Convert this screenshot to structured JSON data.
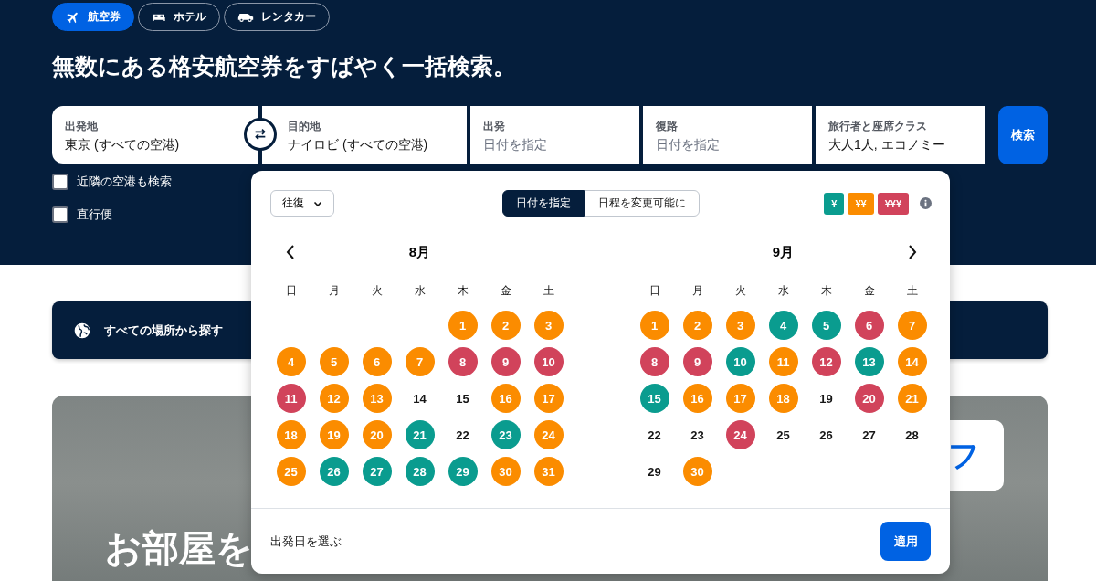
{
  "tabs": [
    {
      "label": "航空券",
      "selected": true
    },
    {
      "label": "ホテル",
      "selected": false
    },
    {
      "label": "レンタカー",
      "selected": false
    }
  ],
  "headline": "無数にある格安航空券をすばやく一括検索。",
  "fields": [
    {
      "label": "出発地",
      "value": "東京 (すべての空港)"
    },
    {
      "label": "目的地",
      "value": "ナイロビ (すべての空港)"
    },
    {
      "label": "出発",
      "placeholder": "日付を指定"
    },
    {
      "label": "復路",
      "placeholder": "日付を指定"
    },
    {
      "label": "旅行者と座席クラス",
      "value": "大人1人, エコノミー"
    }
  ],
  "search_button": "検索",
  "options": [
    {
      "label": "近隣の空港も検索",
      "checked": false
    },
    {
      "label": "直行便",
      "checked": false
    }
  ],
  "explore": "すべての場所から探す",
  "hero": {
    "headline": "お部屋を",
    "card_text": "フ"
  },
  "date_picker": {
    "trip_type": "往復",
    "modes": [
      {
        "label": "日付を指定",
        "selected": true
      },
      {
        "label": "日程を変更可能に",
        "selected": false
      }
    ],
    "legend": [
      {
        "label": "¥",
        "color": "#0a9c8f"
      },
      {
        "label": "¥¥",
        "color": "#fb8c00"
      },
      {
        "label": "¥¥¥",
        "color": "#d1435b"
      }
    ],
    "months": [
      {
        "title": "8月",
        "weekdays": [
          "日",
          "月",
          "火",
          "水",
          "木",
          "金",
          "土"
        ],
        "weeks": [
          [
            {
              "day": "1",
              "color": "#fb8c00"
            },
            {
              "day": "2",
              "color": "#fb8c00"
            },
            {
              "day": "3",
              "color": "#fb8c00"
            }
          ],
          [
            {
              "day": "4",
              "color": "#fb8c00"
            },
            {
              "day": "5",
              "color": "#fb8c00"
            },
            {
              "day": "6",
              "color": "#fb8c00"
            },
            {
              "day": "7",
              "color": "#fb8c00"
            },
            {
              "day": "8",
              "color": "#d1435b"
            },
            {
              "day": "9",
              "color": "#d1435b"
            },
            {
              "day": "10",
              "color": "#d1435b"
            }
          ],
          [
            {
              "day": "11",
              "color": "#d1435b"
            },
            {
              "day": "12",
              "color": "#fb8c00"
            },
            {
              "day": "13",
              "color": "#fb8c00"
            },
            {
              "day": "14"
            },
            {
              "day": "15"
            },
            {
              "day": "16",
              "color": "#fb8c00"
            },
            {
              "day": "17",
              "color": "#fb8c00"
            }
          ],
          [
            {
              "day": "18",
              "color": "#fb8c00"
            },
            {
              "day": "19",
              "color": "#fb8c00"
            },
            {
              "day": "20",
              "color": "#fb8c00"
            },
            {
              "day": "21",
              "color": "#0a9c8f"
            },
            {
              "day": "22"
            },
            {
              "day": "23",
              "color": "#0a9c8f"
            },
            {
              "day": "24",
              "color": "#fb8c00"
            }
          ],
          [
            {
              "day": "25",
              "color": "#fb8c00"
            },
            {
              "day": "26",
              "color": "#0a9c8f"
            },
            {
              "day": "27",
              "color": "#0a9c8f"
            },
            {
              "day": "28",
              "color": "#0a9c8f"
            },
            {
              "day": "29",
              "color": "#0a9c8f"
            },
            {
              "day": "30",
              "color": "#fb8c00"
            },
            {
              "day": "31",
              "color": "#fb8c00"
            }
          ]
        ]
      },
      {
        "title": "9月",
        "weekdays": [
          "日",
          "月",
          "火",
          "水",
          "木",
          "金",
          "土"
        ],
        "weeks": [
          [
            {
              "day": "1",
              "color": "#fb8c00"
            },
            {
              "day": "2",
              "color": "#fb8c00"
            },
            {
              "day": "3",
              "color": "#fb8c00"
            },
            {
              "day": "4",
              "color": "#0a9c8f"
            },
            {
              "day": "5",
              "color": "#0a9c8f"
            },
            {
              "day": "6",
              "color": "#d1435b"
            },
            {
              "day": "7",
              "color": "#fb8c00"
            }
          ],
          [
            {
              "day": "8",
              "color": "#d1435b"
            },
            {
              "day": "9",
              "color": "#d1435b"
            },
            {
              "day": "10",
              "color": "#0a9c8f"
            },
            {
              "day": "11",
              "color": "#fb8c00"
            },
            {
              "day": "12",
              "color": "#d1435b"
            },
            {
              "day": "13",
              "color": "#0a9c8f"
            },
            {
              "day": "14",
              "color": "#fb8c00"
            }
          ],
          [
            {
              "day": "15",
              "color": "#0a9c8f"
            },
            {
              "day": "16",
              "color": "#fb8c00"
            },
            {
              "day": "17",
              "color": "#fb8c00"
            },
            {
              "day": "18",
              "color": "#fb8c00"
            },
            {
              "day": "19"
            },
            {
              "day": "20",
              "color": "#d1435b"
            },
            {
              "day": "21",
              "color": "#fb8c00"
            }
          ],
          [
            {
              "day": "22"
            },
            {
              "day": "23"
            },
            {
              "day": "24",
              "color": "#d1435b"
            },
            {
              "day": "25"
            },
            {
              "day": "26"
            },
            {
              "day": "27"
            },
            {
              "day": "28"
            }
          ],
          [
            {
              "day": "29"
            },
            {
              "day": "30",
              "color": "#fb8c00"
            }
          ]
        ]
      }
    ],
    "footer_text": "出発日を選ぶ",
    "apply_button": "適用"
  }
}
